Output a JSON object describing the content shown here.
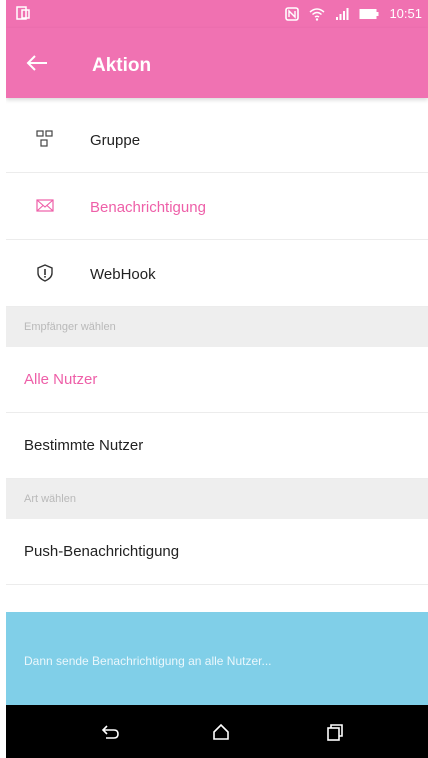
{
  "status_bar": {
    "time": "10:51",
    "icons": [
      "screen-mirror-icon",
      "nfc-icon",
      "wifi-icon",
      "signal-icon",
      "battery-icon"
    ]
  },
  "toolbar": {
    "back_icon": "arrow-left-icon",
    "title": "Aktion"
  },
  "actions": [
    {
      "label": "Gruppe",
      "icon": "group-icon",
      "selected": false
    },
    {
      "label": "Benachrichtigung",
      "icon": "envelope-icon",
      "selected": true
    },
    {
      "label": "WebHook",
      "icon": "shield-alert-icon",
      "selected": false
    }
  ],
  "recipients": {
    "section_label": "Empfänger wählen",
    "options": [
      {
        "label": "Alle Nutzer",
        "selected": true
      },
      {
        "label": "Bestimmte Nutzer",
        "selected": false
      }
    ]
  },
  "type": {
    "section_label": "Art wählen",
    "options": [
      {
        "label": "Push-Benachrichtigung",
        "selected": false
      }
    ]
  },
  "summary": {
    "text": "Dann sende Benachrichtigung an alle Nutzer..."
  },
  "nav_bar": {
    "icons": [
      "back-icon",
      "home-icon",
      "recents-icon"
    ]
  },
  "colors": {
    "primary": "#f072b2",
    "accent_text": "#ee5fa8",
    "summary_bg": "#80cfe8",
    "section_bg": "#eeeeee"
  }
}
